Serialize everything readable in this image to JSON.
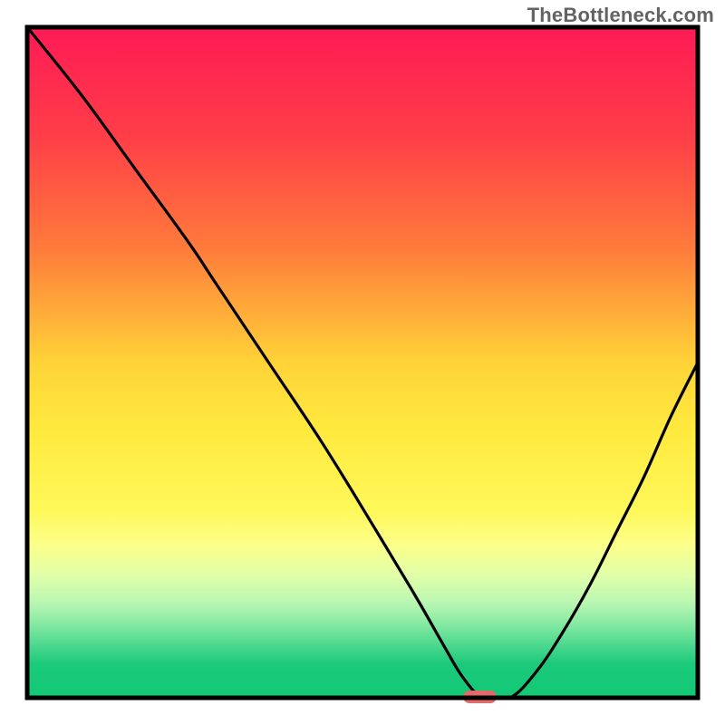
{
  "watermark": "TheBottleneck.com",
  "chart_data": {
    "type": "line",
    "title": "",
    "xlabel": "",
    "ylabel": "",
    "xlim": [
      0,
      100
    ],
    "ylim": [
      0,
      100
    ],
    "background_gradient": {
      "stops": [
        {
          "y_pct": 0,
          "color": "#ff1a55"
        },
        {
          "y_pct": 16,
          "color": "#ff3d48"
        },
        {
          "y_pct": 33,
          "color": "#ff7b3b"
        },
        {
          "y_pct": 50,
          "color": "#ffd338"
        },
        {
          "y_pct": 60,
          "color": "#ffe93e"
        },
        {
          "y_pct": 72,
          "color": "#fff85a"
        },
        {
          "y_pct": 77,
          "color": "#fdff87"
        },
        {
          "y_pct": 82,
          "color": "#dfffab"
        },
        {
          "y_pct": 86,
          "color": "#b7f6b2"
        },
        {
          "y_pct": 89,
          "color": "#85e9a2"
        },
        {
          "y_pct": 92,
          "color": "#4ed98f"
        },
        {
          "y_pct": 95,
          "color": "#1bc97b"
        },
        {
          "y_pct": 100,
          "color": "#13c975"
        }
      ]
    },
    "series": [
      {
        "name": "bottleneck-curve",
        "x": [
          0,
          8,
          16,
          24,
          28,
          36,
          44,
          52,
          58,
          62,
          65,
          68,
          72,
          76,
          80,
          84,
          88,
          92,
          96,
          100
        ],
        "y": [
          100,
          90,
          79,
          68,
          62,
          50,
          38,
          25,
          15,
          8,
          3,
          0,
          0,
          4,
          10,
          17,
          25,
          33,
          42,
          50
        ]
      }
    ],
    "marker": {
      "name": "optimal-point",
      "x_pct_range": [
        65,
        70
      ],
      "y_pct": 0,
      "color": "#e46a6a",
      "note": "rounded pill at curve minimum"
    },
    "axes_border": {
      "color": "#000000",
      "width": 5
    }
  }
}
